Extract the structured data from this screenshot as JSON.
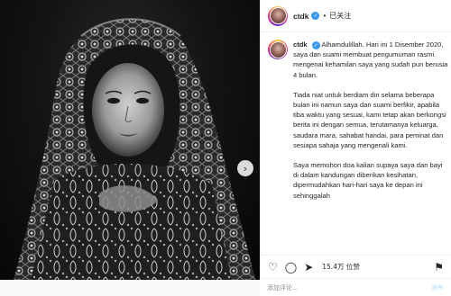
{
  "post": {
    "username": "ctdk",
    "follow_label": "已关注",
    "separator": "•",
    "caption_paragraphs": [
      "Alhamdulillah. Hari ini 1 Disember 2020, saya dan suami membuat pengumuman rasmi mengenai kehamilan saya yang sudah pun berusia 4 bulan.",
      "Tiada niat untuk berdiam diri selama beberapa bulan ini namun saya dan suami berfikir, apabila tiba waktu yang sesuai, kami tetap akan berkongsi berita ini dengan semua, terutamanya keluarga, saudara mara, sahabat handai, para peminat dan sesiapa sahaja yang mengenali kami.",
      "Saya memohon doa kalian supaya saya dan bayi di dalam kandungan diberikan kesihatan, dipermudahkan hari-hari saya ke depan ini sehinggalah"
    ],
    "likes": "15.4万 位赞"
  },
  "comment": {
    "placeholder": "添加评论...",
    "post_label": "发布"
  },
  "icons": {
    "like": "heart-icon",
    "comment": "comment-icon",
    "share": "share-icon",
    "save": "bookmark-icon",
    "next": "chevron-right-icon"
  },
  "colors": {
    "verified": "#3897f0",
    "text": "#262626"
  }
}
